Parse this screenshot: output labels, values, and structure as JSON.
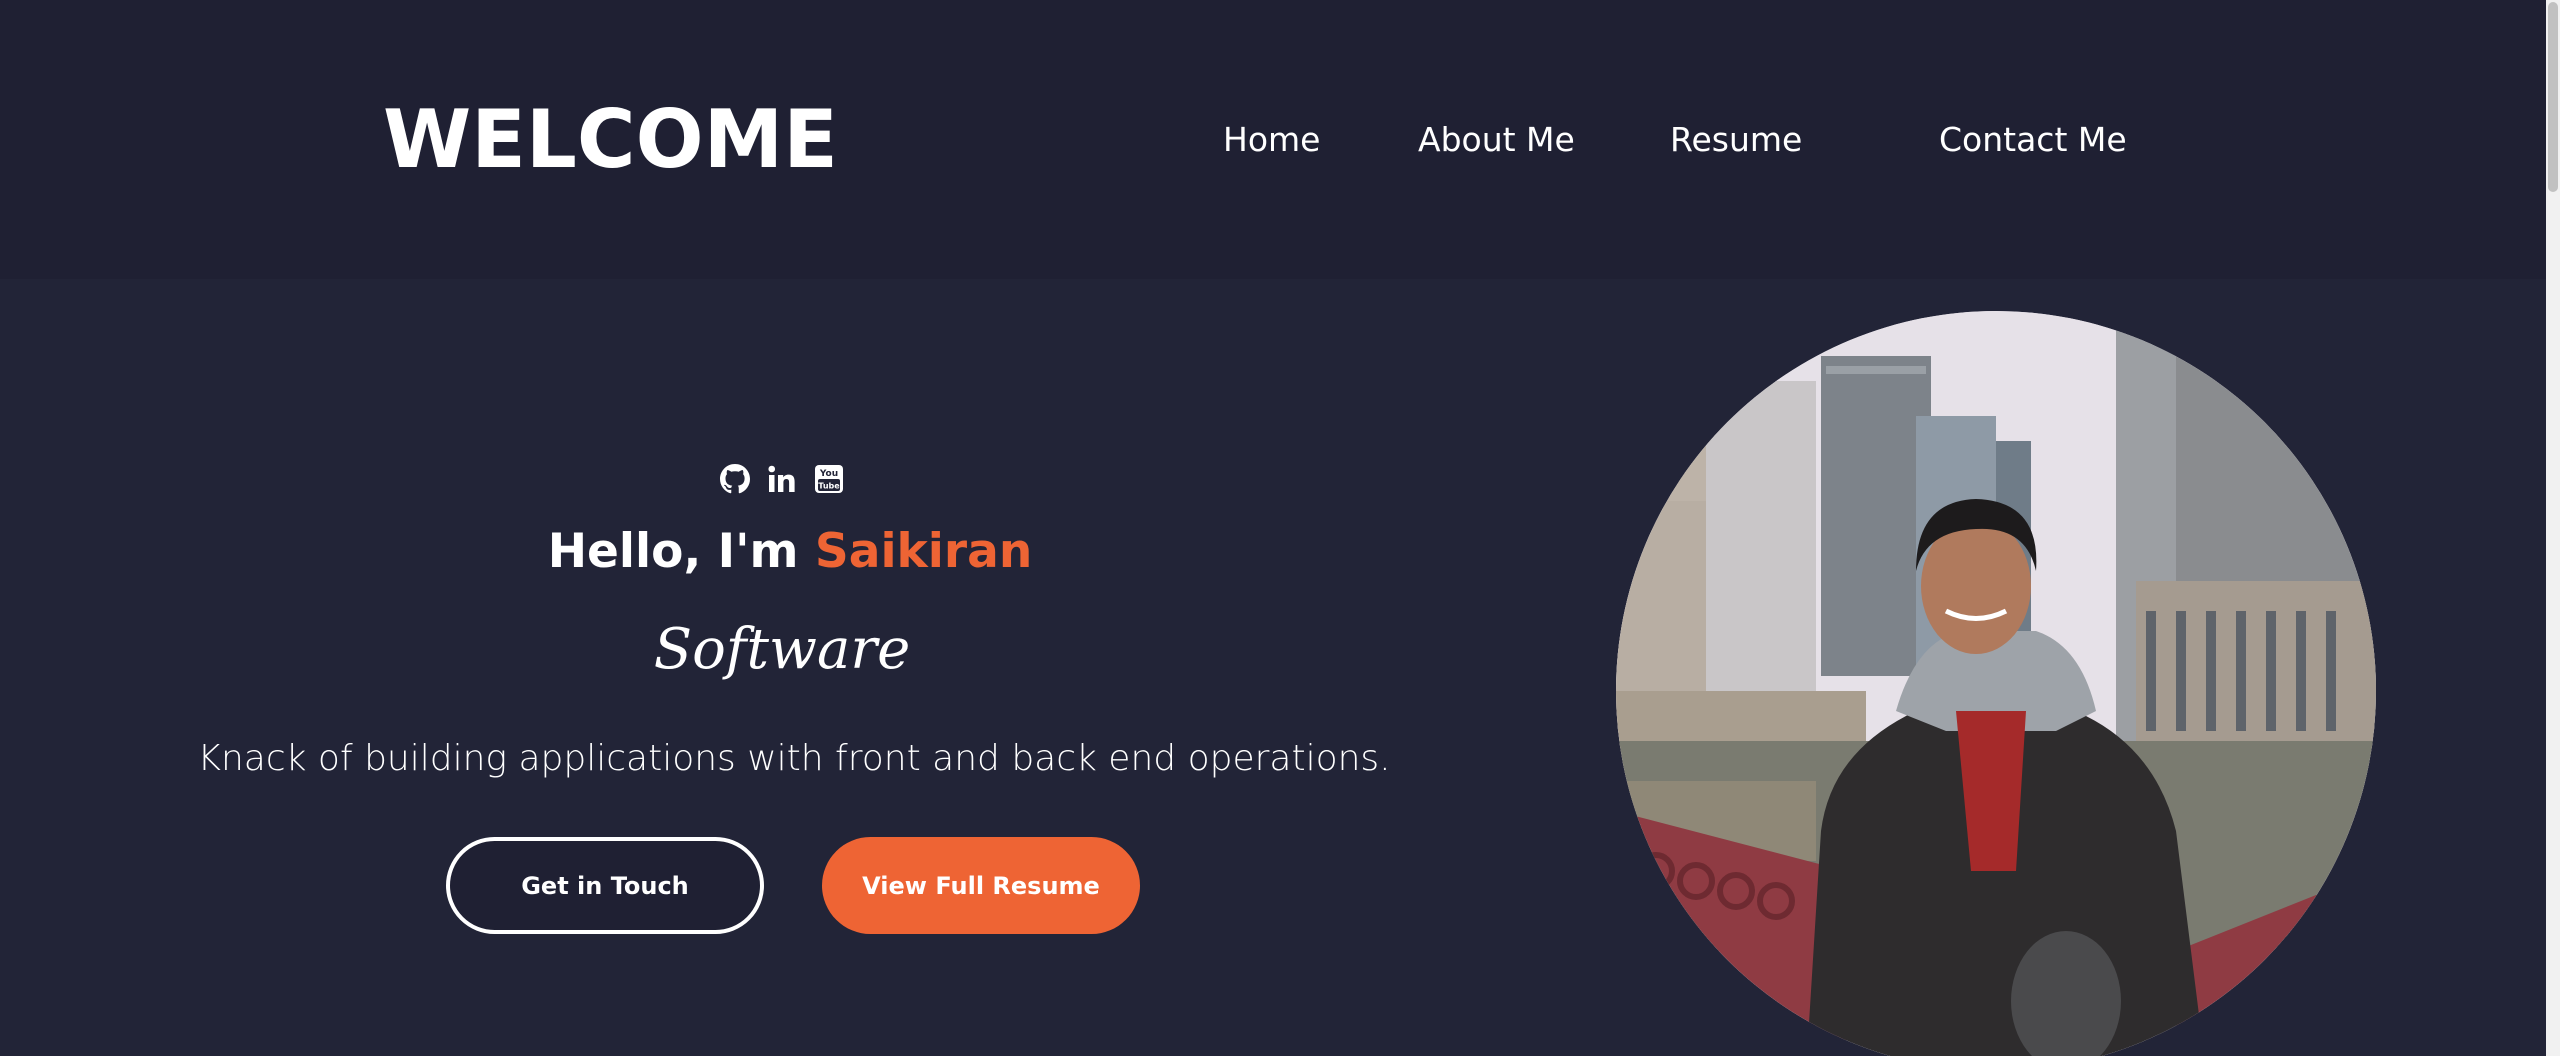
{
  "header": {
    "brand": "WELCOME",
    "nav": {
      "home": "Home",
      "about": "About Me",
      "resume": "Resume",
      "contact": "Contact Me"
    }
  },
  "hero": {
    "social_icons": [
      "github-icon",
      "linkedin-icon",
      "youtube-icon"
    ],
    "hello_prefix": "Hello, I'm ",
    "name": "Saikiran",
    "role": "Software",
    "tagline": "Knack of building applications with front and back end operations.",
    "buttons": {
      "contact": "Get in Touch",
      "resume": "View Full Resume"
    }
  },
  "colors": {
    "header_bg": "#1f2033",
    "page_bg": "#222437",
    "accent": "#ee6434",
    "text": "#ffffff"
  }
}
